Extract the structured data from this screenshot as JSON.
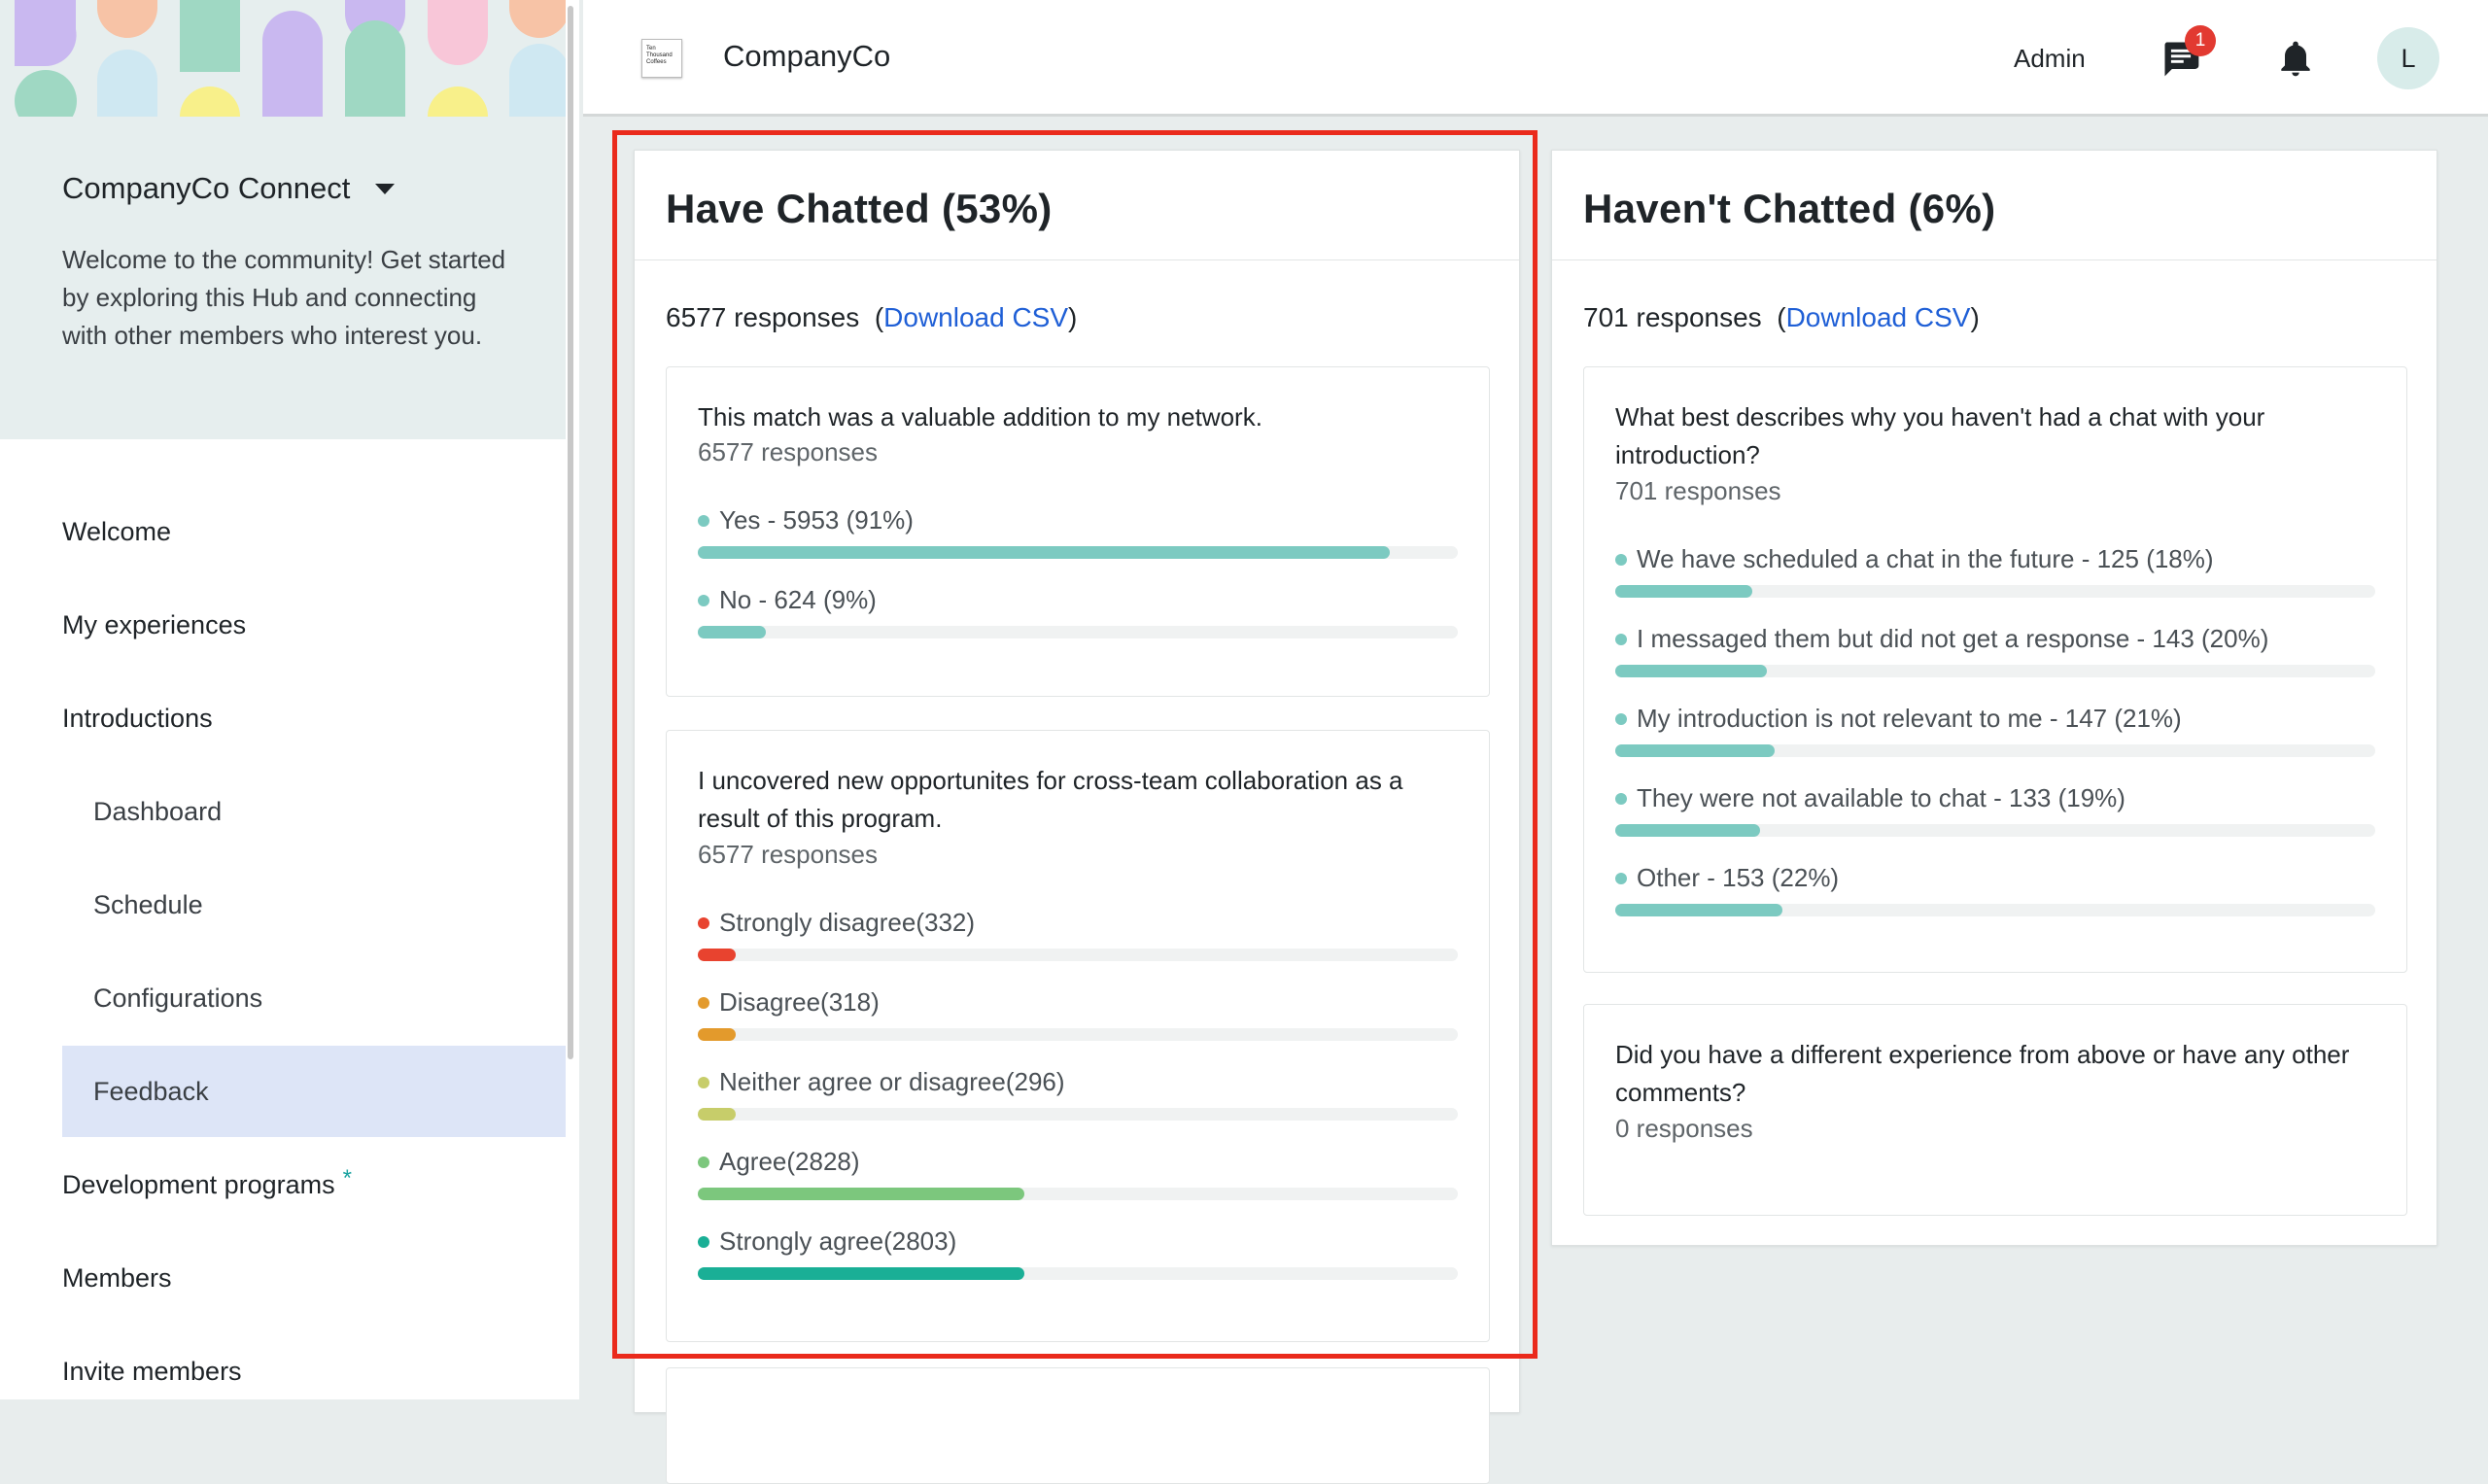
{
  "sidebar": {
    "hub_name": "CompanyCo Connect",
    "hub_description": "Welcome to the community! Get started by exploring this Hub and connecting with other members who interest you.",
    "nav": {
      "welcome": "Welcome",
      "my_experiences": "My experiences",
      "introductions": "Introductions",
      "dashboard": "Dashboard",
      "schedule": "Schedule",
      "configurations": "Configurations",
      "feedback": "Feedback",
      "development_programs": "Development programs",
      "development_marker": "*",
      "members": "Members",
      "invite_members": "Invite members"
    }
  },
  "header": {
    "logo_text": "Ten Thousand Coffees",
    "company": "CompanyCo",
    "admin": "Admin",
    "chat_badge": "1",
    "avatar_initial": "L",
    "icons": [
      "chat-icon",
      "bell-icon"
    ]
  },
  "chatted": {
    "title": "Have Chatted (53%)",
    "responses": "6577 responses",
    "open_paren": "(",
    "download": "Download CSV",
    "close_paren": ")",
    "q1": {
      "title": "This match was a valuable addition to my network.",
      "count": "6577 responses",
      "options": [
        {
          "label": "Yes - 5953 (91%)",
          "fraction": 0.91,
          "color": "#7ccac1"
        },
        {
          "label": "No - 624 (9%)",
          "fraction": 0.09,
          "color": "#7ccac1"
        }
      ]
    },
    "q2": {
      "title": "I uncovered new opportunites for cross-team collaboration as a result of this program.",
      "count": "6577 responses",
      "options": [
        {
          "label": "Strongly disagree(332)",
          "fraction": 0.05,
          "color": "#e8432f"
        },
        {
          "label": "Disagree(318)",
          "fraction": 0.05,
          "color": "#e39a2c"
        },
        {
          "label": "Neither agree or disagree(296)",
          "fraction": 0.05,
          "color": "#c7cd6a"
        },
        {
          "label": "Agree(2828)",
          "fraction": 0.43,
          "color": "#7cc77d"
        },
        {
          "label": "Strongly agree(2803)",
          "fraction": 0.43,
          "color": "#1aaf96"
        }
      ]
    }
  },
  "not_chatted": {
    "title": "Haven't Chatted (6%)",
    "responses": "701 responses",
    "open_paren": "(",
    "download": "Download CSV",
    "close_paren": ")",
    "q1": {
      "title": "What best describes why you haven't had a chat with your introduction?",
      "count": "701 responses",
      "options": [
        {
          "label": "We have scheduled a chat in the future - 125 (18%)",
          "fraction": 0.18,
          "color": "#7ccac1"
        },
        {
          "label": "I messaged them but did not get a response - 143 (20%)",
          "fraction": 0.2,
          "color": "#7ccac1"
        },
        {
          "label": "My introduction is not relevant to me - 147 (21%)",
          "fraction": 0.21,
          "color": "#7ccac1"
        },
        {
          "label": "They were not available to chat - 133 (19%)",
          "fraction": 0.19,
          "color": "#7ccac1"
        },
        {
          "label": "Other - 153 (22%)",
          "fraction": 0.22,
          "color": "#7ccac1"
        }
      ]
    },
    "q2": {
      "title": "Did you have a different experience from above or have any other comments?",
      "count": "0 responses"
    }
  }
}
